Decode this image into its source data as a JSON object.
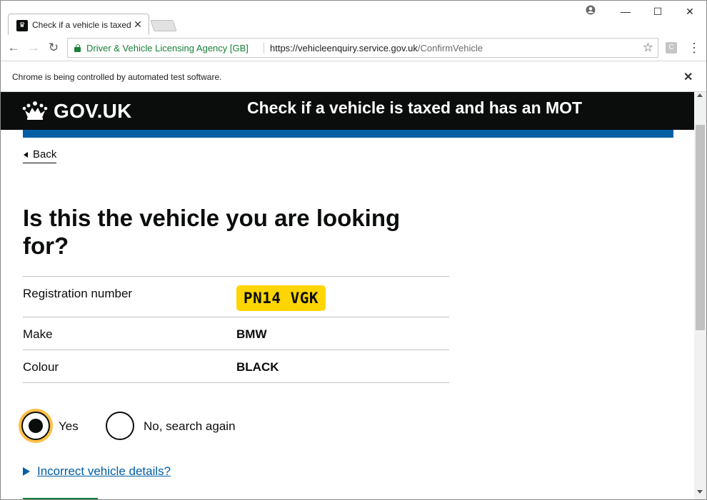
{
  "browser": {
    "tab": {
      "title": "Check if a vehicle is taxed and has an MOT",
      "favicon_icon": "crown-icon",
      "close_glyph": "✕"
    },
    "window_controls": {
      "account": "●",
      "minimize": "—",
      "maximize": "☐",
      "close": "✕"
    },
    "address_bar": {
      "organization": "Driver & Vehicle Licensing Agency [GB]",
      "url_scheme_host": "https://vehicleenquiry.service.gov.uk",
      "url_path": "/ConfirmVehicle"
    },
    "extension_letter": "C",
    "infobar": {
      "text": "Chrome is being controlled by automated test software."
    }
  },
  "header": {
    "logo_text": "GOV.UK",
    "service_name": "Check if a vehicle is taxed and has an MOT",
    "accent_color": "#005ea5"
  },
  "page": {
    "back_link": "Back",
    "heading": "Is this the vehicle you are looking for?",
    "summary": {
      "registration_label": "Registration number",
      "registration_value": "PN14 VGK",
      "make_label": "Make",
      "make_value": "BMW",
      "colour_label": "Colour",
      "colour_value": "BLACK"
    },
    "radios": {
      "yes_label": "Yes",
      "no_label": "No, search again",
      "selected": "yes"
    },
    "details_link": "Incorrect vehicle details?"
  }
}
